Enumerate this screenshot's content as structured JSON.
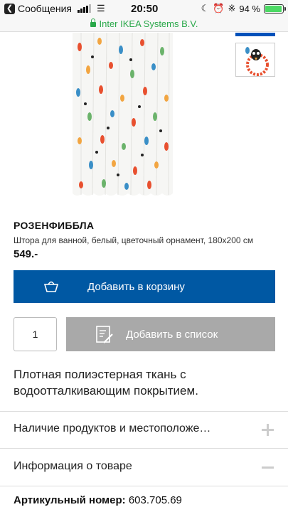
{
  "status_bar": {
    "back_app": "Сообщения",
    "time": "20:50",
    "battery": "94 %",
    "battery_level": 0.94
  },
  "url_bar": {
    "site": "Inter IKEA Systems B.V."
  },
  "product": {
    "name": "РОЗЕНФИББЛА",
    "description": "Штора для ванной, белый, цветочный орнамент, 180x200 см",
    "price": "549.-"
  },
  "actions": {
    "add_to_cart": "Добавить в корзину",
    "quantity": "1",
    "add_to_list": "Добавить в список"
  },
  "summary": "Плотная полиэстерная ткань с водоотталкивающим покрытием.",
  "accordion": [
    {
      "label": "Наличие продуктов и местоположе…",
      "state": "collapsed"
    },
    {
      "label": "Информация о товаре",
      "state": "expanded"
    }
  ],
  "article": {
    "label": "Артикульный номер:",
    "number": "603.705.69"
  },
  "colors": {
    "primary_blue": "#0058a3",
    "disabled_gray": "#a9a9a9",
    "secure_green": "#2aa84a"
  }
}
